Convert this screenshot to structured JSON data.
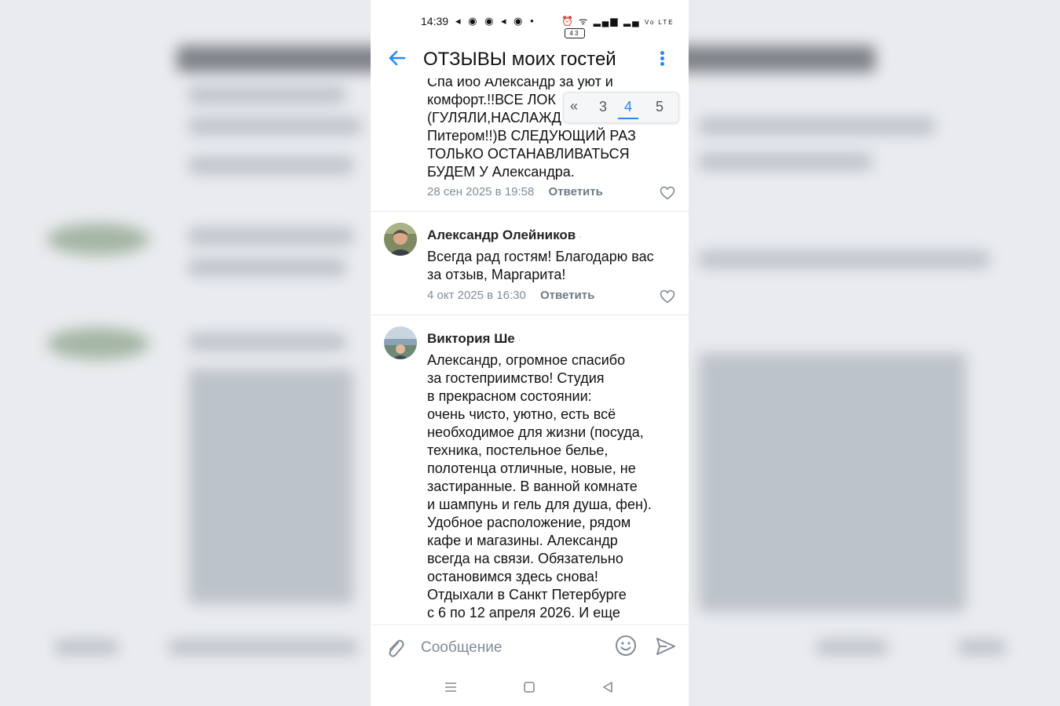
{
  "status_bar": {
    "time": "14:39",
    "left_icons": "◂ ◉ ◉ ◂ ◉ •",
    "right_icons": "⏰ ᯤ ▂▄▆ ▂▄",
    "network": "Vo LTE",
    "battery": "43"
  },
  "header": {
    "title": "ОТЗЫВЫ моих гостей"
  },
  "pager": {
    "prev_icon": "«",
    "pages": [
      "3",
      "4",
      "5"
    ],
    "current": "4"
  },
  "comments": [
    {
      "text_lines": [
        "Спа ибо Александр за уют и",
        "комфорт.!!ВСЕ ЛОК",
        "(ГУЛЯЛИ,НАСЛАЖД",
        "Питером!!)В СЛЕДУЮЩИЙ РАЗ",
        "ТОЛЬКО ОСТАНАВЛИВАТЬСЯ",
        "БУДЕМ  У Александра."
      ],
      "date": "28 сен 2025 в 19:58",
      "reply_label": "Ответить"
    },
    {
      "author": "Александр Олейников",
      "text_lines": [
        "Всегда рад гостям! Благодарю вас",
        "за отзыв, Маргарита!"
      ],
      "date": "4 окт 2025 в 16:30",
      "reply_label": "Ответить"
    },
    {
      "author": "Виктория Ше",
      "text_lines": [
        "Александр, огромное спасибо",
        "за гостеприимство! Студия",
        "в прекрасном состоянии:",
        "очень чисто, уютно, есть всё",
        "необходимое для жизни (посуда,",
        "техника, постельное белье,",
        "полотенца отличные, новые, не",
        "застиранные. В ванной комнате",
        "и шампунь и гель для душа, фен).",
        "Удобное расположение, рядом",
        "кафе и магазины. Александр",
        "всегда на связи. Обязательно",
        "остановимся здесь снова!",
        "Отдыхали в Санкт Петербурге",
        "с 6 по 12 апреля 2026. И еще"
      ]
    }
  ],
  "composer": {
    "placeholder": "Сообщение"
  },
  "colors": {
    "accent": "#2787f5",
    "meta": "#818c99"
  }
}
